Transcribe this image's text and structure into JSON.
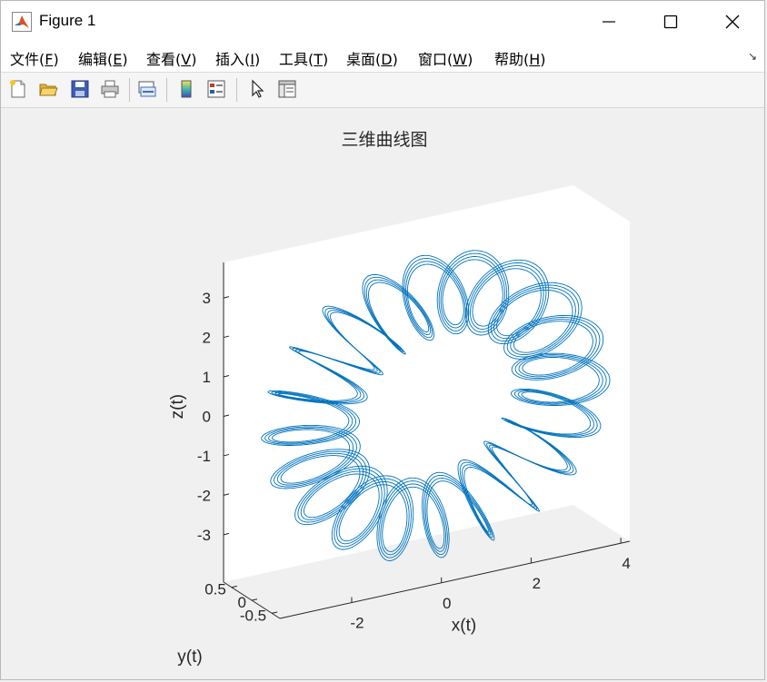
{
  "window": {
    "title": "Figure 1",
    "controls": {
      "minimize": "minimize",
      "maximize": "maximize",
      "close": "close"
    }
  },
  "menu": {
    "items": [
      {
        "label": "文件(",
        "key": "F",
        "end": ")"
      },
      {
        "label": "编辑(",
        "key": "E",
        "end": ")"
      },
      {
        "label": "查看(",
        "key": "V",
        "end": ")"
      },
      {
        "label": "插入(",
        "key": "I",
        "end": ")"
      },
      {
        "label": "工具(",
        "key": "T",
        "end": ")"
      },
      {
        "label": "桌面(",
        "key": "D",
        "end": ")"
      },
      {
        "label": "窗口(",
        "key": "W",
        "end": ")"
      },
      {
        "label": "帮助(",
        "key": "H",
        "end": ")"
      }
    ]
  },
  "toolbar": {
    "icons": [
      "new-figure-icon",
      "open-file-icon",
      "save-icon",
      "print-icon",
      "link-plot-icon",
      "colorbar-icon",
      "legend-icon",
      "edit-plot-icon",
      "property-inspector-icon"
    ]
  },
  "axes": {
    "title": "三维曲线图",
    "xlabel": "x(t)",
    "ylabel": "y(t)",
    "zlabel": "z(t)"
  },
  "chart_data": {
    "type": "line",
    "dimensions": 3,
    "title": "三维曲线图",
    "xlabel": "x(t)",
    "ylabel": "y(t)",
    "zlabel": "z(t)",
    "xticks": [
      "-2",
      "0",
      "2",
      "4"
    ],
    "yticks": [
      "-0.5",
      "0",
      "0.5"
    ],
    "zticks": [
      "-3",
      "-2",
      "-1",
      "0",
      "1",
      "2",
      "3"
    ],
    "xlim": [
      -3.6,
      4.2
    ],
    "ylim": [
      -0.7,
      0.7
    ],
    "zlim": [
      -4.2,
      3.9
    ],
    "grid": false,
    "line_color": "#0072bd",
    "series": [
      {
        "strands": 4,
        "revolutions": 1,
        "coils": 20,
        "major_radius": 2.8,
        "minor_radius": 0.85,
        "strand_offset": 0.07,
        "center": [
          0.5,
          0,
          -0.3
        ]
      }
    ]
  },
  "colors": {
    "background": "#f0f0f0",
    "axes_bg": "#ffffff",
    "line": "#0072bd",
    "text": "#262626"
  }
}
